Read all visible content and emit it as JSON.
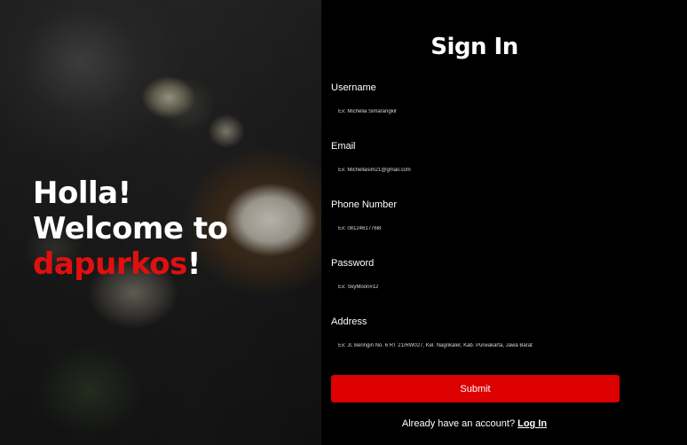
{
  "hero": {
    "line1": "Holla!",
    "line2": "Welcome to",
    "brand": "dapurkos",
    "exclaim": "!"
  },
  "form": {
    "title": "Sign In",
    "fields": [
      {
        "label": "Username",
        "placeholder": "Ex: Michelia Simarangkir"
      },
      {
        "label": "Email",
        "placeholder": "Ex: Michellasim21@gmail.com"
      },
      {
        "label": "Phone Number",
        "placeholder": "Ex: 0812461776l8"
      },
      {
        "label": "Password",
        "placeholder": "Ex: SkyMoon#12"
      },
      {
        "label": "Address",
        "placeholder": "Ex: Jl. Beringin No. 6 RT 21/RW027, Kel. Nagrikaler, Kab. Purwakarta, Jawa Barat"
      }
    ],
    "submit_label": "Submit",
    "footer_text": "Already have an account?",
    "login_link": "Log In"
  },
  "colors": {
    "accent": "#dc0000",
    "background": "#000000"
  }
}
